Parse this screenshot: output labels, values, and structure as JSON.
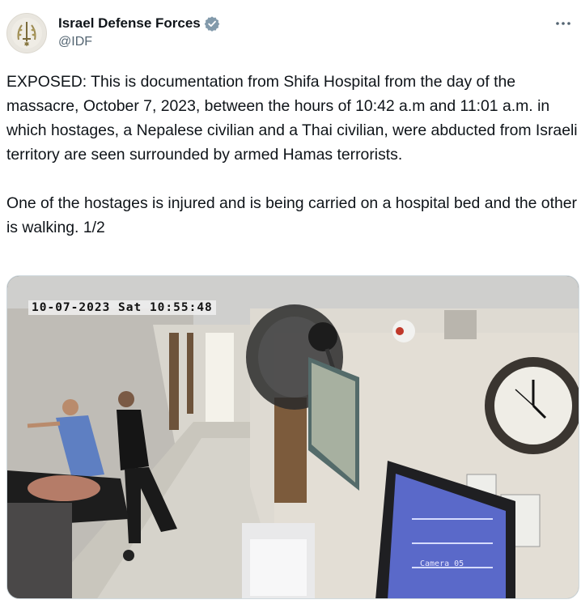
{
  "author": {
    "display_name": "Israel Defense Forces",
    "handle": "@IDF",
    "verified": true,
    "avatar_icon": "idf-emblem-icon"
  },
  "more_icon": "more-options-icon",
  "tweet": {
    "text": "EXPOSED: This is documentation from Shifa Hospital from the day of the massacre, October 7, 2023, between the hours of 10:42 a.m and 11:01 a.m. in which hostages, a Nepalese civilian and a Thai civilian, were abducted from Israeli territory are seen surrounded by armed Hamas terrorists.\n\nOne of the hostages is injured and is being carried on a hospital bed and the other is walking. 1/2"
  },
  "media": {
    "timestamp": "10-07-2023 Sat 10:55:48",
    "camera_label": "Camera 05"
  },
  "colors": {
    "text": "#0f1419",
    "secondary": "#536471",
    "verified_badge": "#829aab",
    "border": "#cfd9de"
  }
}
